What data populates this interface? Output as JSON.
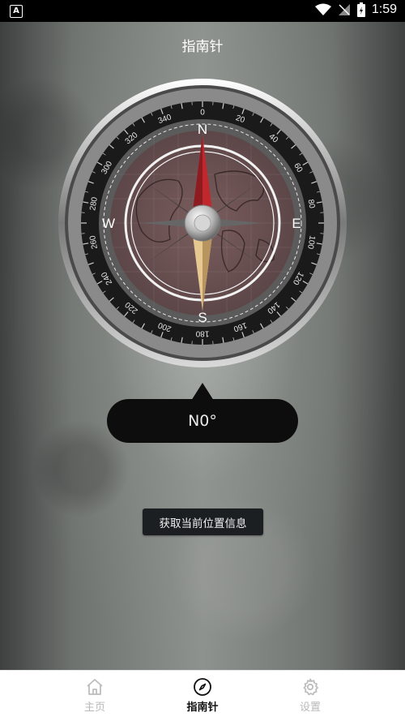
{
  "status": {
    "time": "1:59",
    "left_badge": "A"
  },
  "header": {
    "title": "指南针"
  },
  "compass": {
    "heading_display": "N0°",
    "cardinals": {
      "n": "N",
      "e": "E",
      "s": "S",
      "w": "W"
    },
    "degree_labels": [
      "0",
      "20",
      "40",
      "60",
      "80",
      "100",
      "120",
      "140",
      "160",
      "180",
      "200",
      "220",
      "240",
      "260",
      "280",
      "300",
      "320",
      "340"
    ]
  },
  "actions": {
    "get_location_label": "获取当前位置信息"
  },
  "tabs": [
    {
      "label": "主页",
      "icon": "home-icon",
      "active": false
    },
    {
      "label": "指南针",
      "icon": "compass-icon",
      "active": true
    },
    {
      "label": "设置",
      "icon": "gear-icon",
      "active": false
    }
  ],
  "colors": {
    "needle_north": "#c0282e",
    "needle_south": "#e8c891",
    "tab_active": "#111111",
    "tab_inactive": "#b9b9b9"
  }
}
